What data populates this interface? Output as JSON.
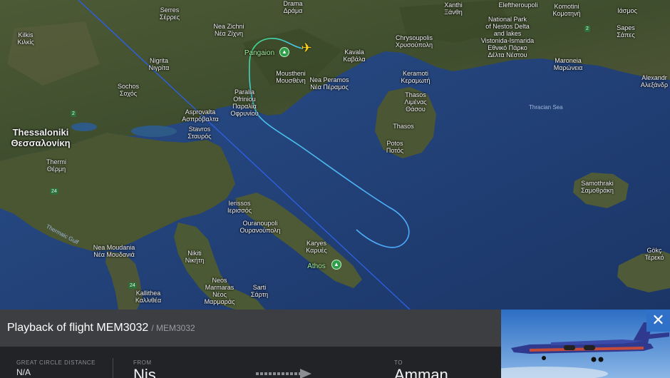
{
  "map": {
    "labels": {
      "serres": "Serres\nΣέρρες",
      "nea_zichni": "Nea Zichni\nΝέα Ζίχνη",
      "pangaion": "Pangaion",
      "kilkis": "Kilkis\nΚιλκίς",
      "nigrita": "Nigrita\nΝιγρίτα",
      "sochos": "Sochos\nΣοχός",
      "paralia_ofriniou": "Paralia\nOfriniou\nΠαραλία\nΟφρυνίου",
      "moustheni": "Moustheni\nΜουσθένη",
      "nea_peramos": "Nea Peramos\nΝέα Πέραμος",
      "kavala": "Kavala\nΚαβάλα",
      "chrysoupolis": "Chrysoupolis\nΧρυσούπολη",
      "national_park": "National Park\nof Nestos Delta\nand lakes\nVistonida-Ismarida\nΕθνικό Πάρκο\nΔέλτα Νέστου",
      "keramoti": "Keramoti\nΚεραμωτή",
      "thasos_town": "Thasos\nΛιμένας\nΘάσου",
      "thasos_island": "Thasos",
      "potos": "Potos\nΠοτός",
      "maroneia": "Maroneia\nΜαρώνεια",
      "sapes": "Sapes\nΣάπες",
      "alexandroupoli": "Alexandr\nΑλεξάνδρ",
      "thracian_sea": "Thracian Sea",
      "thessaloniki": "Thessaloniki\nΘεσσαλονίκη",
      "thermi": "Thermi\nΘέρμη",
      "asprovalta": "Asprovalta\nΑσπρόβαλτα",
      "stavros": "Stavros\nΣταυρός",
      "samothraki": "Samothraki\nΣαμοθράκη",
      "ierissos": "Ierissos\nΙερισσός",
      "ouranoupoli": "Ouranoupoli\nΟυρανούπολη",
      "karyes": "Karyes\nΚαρυές",
      "athos": "Athos",
      "thermaic_gulf": "Thermaic Gulf",
      "nea_moudania": "Nea Moudania\nΝέα Μουδανιά",
      "nikiti": "Nikiti\nΝικήτη",
      "neos_marmaras": "Neos\nMarmaras\nΝέος\nΜαρμαράς",
      "sarti": "Sarti\nΣάρτη",
      "kallithea": "Kallithea\nΚαλλιθέα",
      "gokceada": "Gökç\nΤέρεκό",
      "komotini": "Komotini\nΚομοτηνή",
      "xanthi": "Xanthi\nΞάνθη",
      "drama": "Drama\nΔράμα",
      "eleftheroupoli": "Eleftheroupoli",
      "aggelochori": "Ιάσμος"
    },
    "road_badges": {
      "r2": "2",
      "r24a": "24",
      "r24b": "24",
      "r2b": "2"
    },
    "colors": {
      "track_start": "#3fe07a",
      "track_end": "#4fa8ff",
      "great_circle": "#2d5fe0",
      "aircraft": "#ffd21a"
    }
  },
  "panel": {
    "title": "Playback of flight MEM3032",
    "subtitle": "/ MEM3032",
    "great_circle_label": "GREAT CIRCLE DISTANCE",
    "great_circle_value": "N/A",
    "from_label": "FROM",
    "from_value": "Nis",
    "to_label": "TO",
    "to_value": "Amman"
  },
  "photo": {
    "close_icon": "close-icon",
    "close_glyph": "✕"
  }
}
